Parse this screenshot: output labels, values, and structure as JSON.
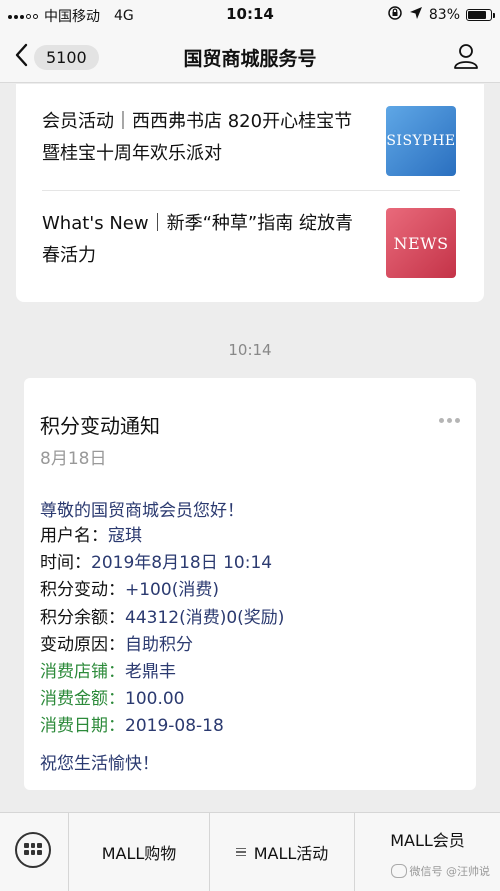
{
  "status_bar": {
    "carrier": "中国移动",
    "network": "4G",
    "time": "10:14",
    "battery": "83%",
    "battery_level": 0.83
  },
  "nav": {
    "back_count": "5100",
    "title": "国贸商城服务号"
  },
  "articles": [
    {
      "text": "会员活动｜西西弗书店 820开心桂宝节暨桂宝十周年欢乐派对",
      "thumb_label": "SISYPHE",
      "thumb_color": "#3d86d3"
    },
    {
      "text": "What's New｜新季“种草”指南 绽放青春活力",
      "thumb_label": "NEWS",
      "thumb_color": "#d44a5c"
    }
  ],
  "timestamp": "10:14",
  "notice": {
    "title": "积分变动通知",
    "date": "8月18日",
    "greeting": "尊敬的国贸商城会员您好！",
    "rows": [
      {
        "label": "用户名：",
        "value": "寇琪"
      },
      {
        "label": "时间：",
        "value": "2019年8月18日 10:14"
      },
      {
        "label": "积分变动：",
        "value": "+100(消费)"
      },
      {
        "label": "积分余额：",
        "value": "44312(消费)0(奖励)"
      },
      {
        "label": "变动原因：",
        "value": "自助积分"
      },
      {
        "label": "消费店铺：",
        "value": "老鼎丰"
      },
      {
        "label": "消费金额：",
        "value": "100.00"
      },
      {
        "label": "消费日期：",
        "value": "2019-08-18"
      }
    ],
    "closing": "祝您生活愉快！"
  },
  "menu": {
    "items": [
      "MALL购物",
      "MALL活动",
      "MALL会员"
    ]
  },
  "watermark": "微信号 @汪帅说",
  "colors": {
    "link_blue": "#2b3a70",
    "label_green": "#2c8a3a",
    "background": "#ededed"
  }
}
